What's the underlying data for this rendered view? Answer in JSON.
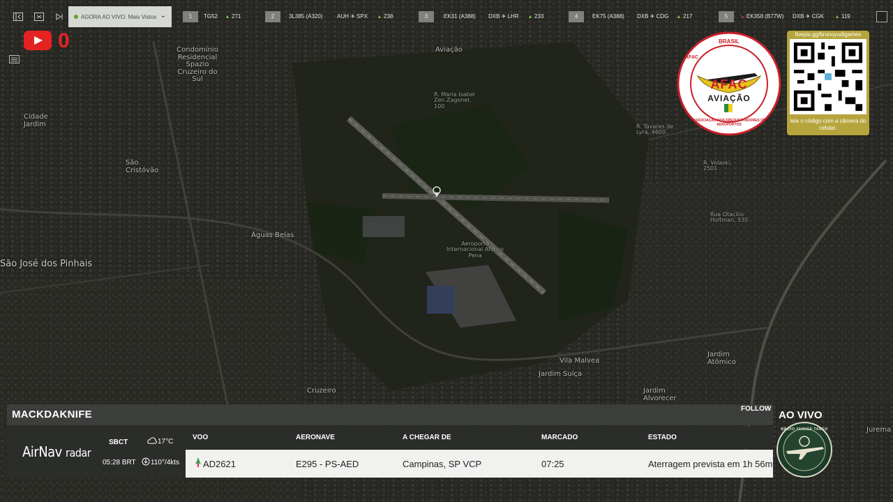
{
  "topbar": {
    "now_label": "AGORA AO VIVO: Mais Vistos",
    "flights": [
      {
        "rank": "1",
        "code": "TG52",
        "route": "",
        "count": "271"
      },
      {
        "rank": "2",
        "code": "3L385 (A320)",
        "route": "AUH ✈ SPX",
        "count": "238"
      },
      {
        "rank": "3",
        "code": "EK31 (A388)",
        "route": "DXB ✈ LHR",
        "count": "233"
      },
      {
        "rank": "4",
        "code": "EK75 (A388)",
        "route": "DXB ✈ CDG",
        "count": "217"
      },
      {
        "rank": "5",
        "code": "EK358 (B77W)",
        "route": "DXB ✈ CGK",
        "count": "119"
      }
    ]
  },
  "youtube": {
    "count": "0"
  },
  "map_labels": {
    "condominio": "Condomínio Residencial Spazio Cruzeiro do Sul",
    "cidade_jardim": "Cidade Jardim",
    "aviacao": "Aviação",
    "sao_cristovao": "São Cristóvão",
    "aguas_belas": "Águas Belas",
    "sjp": "São José dos Pinhais",
    "airport": "Aeroporto Internacional Afonso Pena",
    "vila_malvea": "Vila Malvea",
    "jardim_suica": "Jardim Suíça",
    "jardim_atomico": "Jardim Atômico",
    "jardim_alvorecer": "Jardim Alvorecer",
    "cruzeiro": "Cruzeiro",
    "jurema": "Jurema",
    "rua_isabel": "R. Maria Isabel Zen Zagonel, 100",
    "rua_tavares": "R. Tavares de Lyra, 4600",
    "rua_volaski": "R. Volaski, 2501",
    "rua_holtman": "Rua Otacílio Holtman, 535"
  },
  "logos": {
    "afac_top": "BRASIL",
    "afac_side": "AFAC",
    "afac_mid": "AFAC",
    "afac_word": "AVIAÇÃO",
    "afac_ring": "ASSOCIAÇÃO DOS FREQUENTADORES DE AEROPORTOS",
    "qr_url": "livepix.gg/brunoyudigames",
    "qr_caption": "leia o código com a câmera do celular."
  },
  "panel": {
    "callsign": "MACKDAKNIFE",
    "follow": "FOLLOW",
    "brand_main": "AirNav",
    "brand_sub": "radar",
    "airport": "SBCT",
    "time": "05:28 BRT",
    "temp": "17°C",
    "wind": "110°/4kts",
    "headers": {
      "voo": "VOO",
      "aeronave": "AERONAVE",
      "origem": "A CHEGAR DE",
      "marcado": "MARCADO",
      "estado": "ESTADO"
    },
    "row": {
      "voo": "AD2621",
      "aeronave": "E295 - PS-AED",
      "origem": "Campinas, SP VCP",
      "marcado": "07:25",
      "estado": "Aterragem prevista em 1h 56m"
    }
  },
  "live": {
    "label": "AO VIVO",
    "badge_text": "BRAVO YANKEE TANGO"
  },
  "colors": {
    "accent_green": "#7ecb3a",
    "youtube_red": "#e52222",
    "qr_gold": "#b6a53c"
  }
}
